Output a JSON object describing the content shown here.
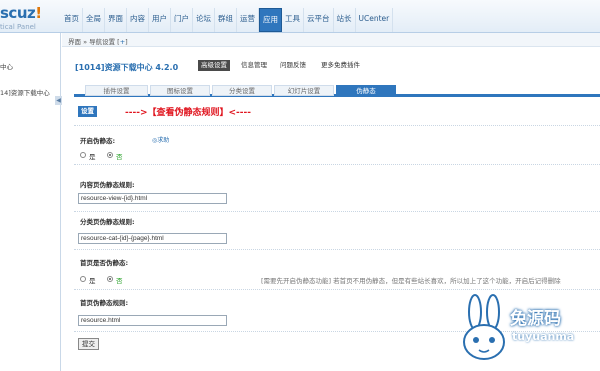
{
  "brand": {
    "logo_text_a": "scuz",
    "logo_text_b": "!",
    "logo_sub": "tical Panel"
  },
  "nav": [
    "首页",
    "全局",
    "界面",
    "内容",
    "用户",
    "门户",
    "论坛",
    "群组",
    "运营",
    "应用",
    "工具",
    "云平台",
    "站长",
    "UCenter"
  ],
  "nav_active": "应用",
  "sidebar": {
    "items": [
      "中心",
      "14]资源下载中心"
    ]
  },
  "breadcrumb": {
    "text": "界面 » 导航设置 [",
    "link": "+",
    "end": "]"
  },
  "plugin": {
    "title": "[1014]资源下载中心 4.2.0",
    "header_links": [
      "高级设置",
      "信息管理",
      "问题反馈",
      "更多免费插件"
    ],
    "tabs": [
      "插件设置",
      "图标设置",
      "分类设置",
      "幻灯片设置",
      "伪静态"
    ],
    "active_tab": "伪静态"
  },
  "section": {
    "badge": "设置",
    "headline": "---->【查看伪静态规则】<----"
  },
  "form": {
    "enable_label": "开启伪静态:",
    "enable_help": "◎求助",
    "radio_yes": "是",
    "radio_no": "否",
    "content_label": "内容页伪静态规则:",
    "content_value": "resource-view-{id}.html",
    "category_label": "分类页伪静态规则:",
    "category_value": "resource-cat-{id}-{page}.html",
    "home_enable_label": "首页是否伪静态:",
    "home_tip": "[需要先开启伪静态功能]    若首页不用伪静态，但是有些站长喜欢，所以加上了这个功能，开启后记得删除",
    "home_rule_label": "首页伪静态规则:",
    "home_rule_value": "resource.html",
    "submit": "提交"
  },
  "watermark": {
    "cn": "兔源码",
    "en": "tuyuanma"
  }
}
